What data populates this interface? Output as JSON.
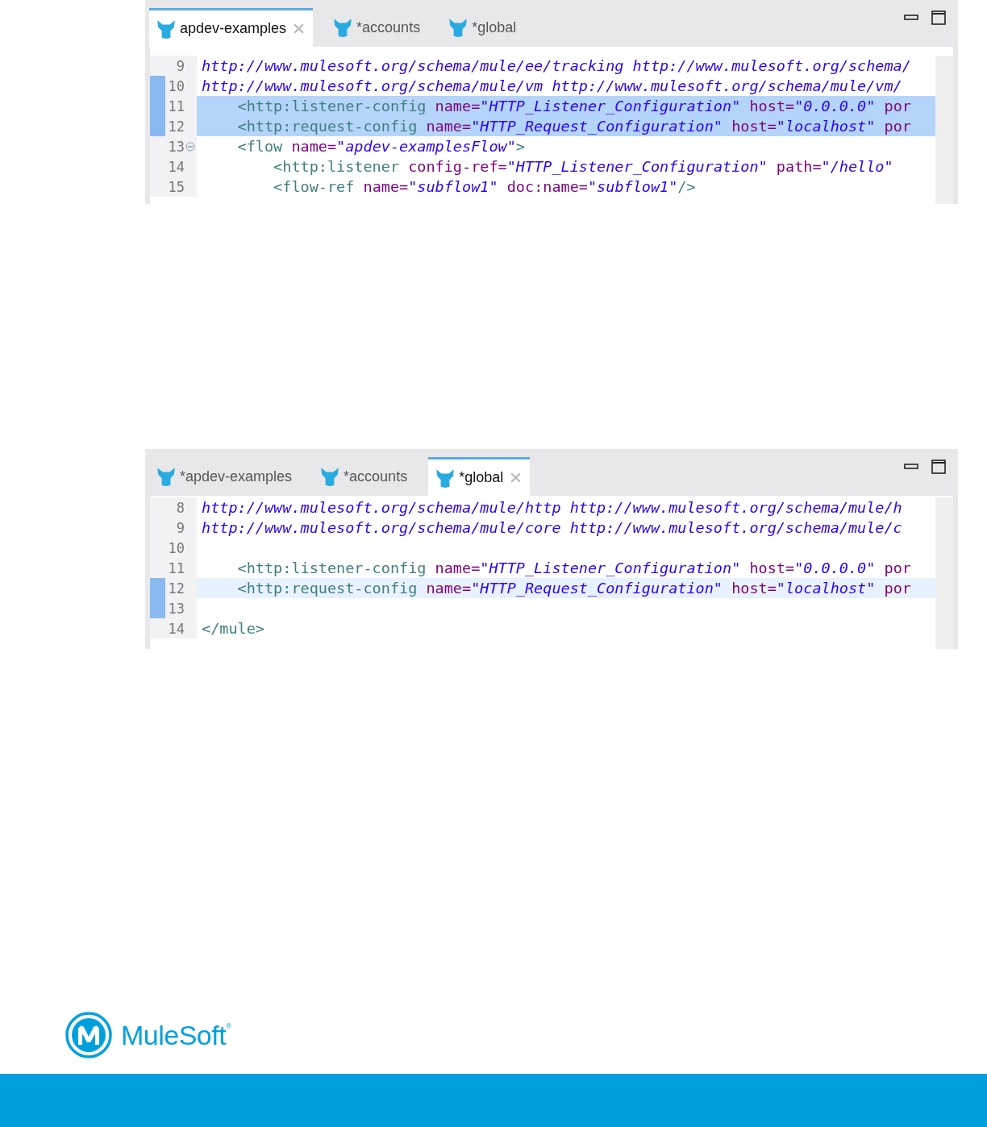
{
  "editors": [
    {
      "tabs": [
        {
          "label": "apdev-examples",
          "selected": true
        },
        {
          "label": "*accounts",
          "selected": false
        },
        {
          "label": "*global",
          "selected": false
        }
      ],
      "lines": [
        {
          "number": "9",
          "selected": false,
          "current": false,
          "changed": false,
          "fold": false,
          "tokens": [
            {
              "kind": "url",
              "text": "http://www.mulesoft.org/schema/mule/ee/tracking http://www.mulesoft.org/schema/"
            }
          ]
        },
        {
          "number": "10",
          "selected": false,
          "current": false,
          "changed": true,
          "fold": false,
          "tokens": [
            {
              "kind": "url",
              "text": "http://www.mulesoft.org/schema/mule/vm http://www.mulesoft.org/schema/mule/vm/"
            }
          ]
        },
        {
          "number": "11",
          "selected": true,
          "current": false,
          "changed": true,
          "fold": false,
          "tokens": [
            {
              "kind": "tag",
              "text": "    <http:listener-config"
            },
            {
              "kind": "attr",
              "text": " name="
            },
            {
              "kind": "value",
              "text": "\"HTTP_Listener_Configuration\""
            },
            {
              "kind": "attr",
              "text": " host="
            },
            {
              "kind": "value",
              "text": "\"0.0.0.0\""
            },
            {
              "kind": "attr",
              "text": " por"
            }
          ]
        },
        {
          "number": "12",
          "selected": true,
          "current": false,
          "changed": true,
          "fold": false,
          "tokens": [
            {
              "kind": "tag",
              "text": "    <http:request-config"
            },
            {
              "kind": "attr",
              "text": " name="
            },
            {
              "kind": "value",
              "text": "\"HTTP_Request_Configuration\""
            },
            {
              "kind": "attr",
              "text": " host="
            },
            {
              "kind": "value",
              "text": "\"localhost\""
            },
            {
              "kind": "attr",
              "text": " por"
            }
          ]
        },
        {
          "number": "13",
          "selected": false,
          "current": false,
          "changed": false,
          "fold": true,
          "tokens": [
            {
              "kind": "tag",
              "text": "    <flow"
            },
            {
              "kind": "attr",
              "text": " name="
            },
            {
              "kind": "value",
              "text": "\"apdev-examplesFlow\""
            },
            {
              "kind": "tag",
              "text": ">"
            }
          ]
        },
        {
          "number": "14",
          "selected": false,
          "current": false,
          "changed": false,
          "fold": false,
          "tokens": [
            {
              "kind": "tag",
              "text": "        <http:listener"
            },
            {
              "kind": "attr",
              "text": " config-ref="
            },
            {
              "kind": "value",
              "text": "\"HTTP_Listener_Configuration\""
            },
            {
              "kind": "attr",
              "text": " path="
            },
            {
              "kind": "value",
              "text": "\"/hello\""
            }
          ]
        },
        {
          "number": "15",
          "selected": false,
          "current": false,
          "changed": false,
          "fold": false,
          "tokens": [
            {
              "kind": "tag",
              "text": "        <flow-ref"
            },
            {
              "kind": "attr",
              "text": " name="
            },
            {
              "kind": "value",
              "text": "\"subflow1\""
            },
            {
              "kind": "attr",
              "text": " doc:name="
            },
            {
              "kind": "value",
              "text": "\"subflow1\""
            },
            {
              "kind": "tag",
              "text": "/>"
            }
          ]
        }
      ]
    },
    {
      "tabs": [
        {
          "label": "*apdev-examples",
          "selected": false
        },
        {
          "label": "*accounts",
          "selected": false
        },
        {
          "label": "*global",
          "selected": true
        }
      ],
      "lines": [
        {
          "number": "8",
          "selected": false,
          "current": false,
          "changed": false,
          "fold": false,
          "tokens": [
            {
              "kind": "url",
              "text": "http://www.mulesoft.org/schema/mule/http http://www.mulesoft.org/schema/mule/h"
            }
          ]
        },
        {
          "number": "9",
          "selected": false,
          "current": false,
          "changed": false,
          "fold": false,
          "tokens": [
            {
              "kind": "url",
              "text": "http://www.mulesoft.org/schema/mule/core http://www.mulesoft.org/schema/mule/c"
            }
          ]
        },
        {
          "number": "10",
          "selected": false,
          "current": false,
          "changed": false,
          "fold": false
        },
        {
          "number": "11",
          "selected": false,
          "current": false,
          "changed": false,
          "fold": false,
          "tokens": [
            {
              "kind": "tag",
              "text": "    <http:listener-config"
            },
            {
              "kind": "attr",
              "text": " name="
            },
            {
              "kind": "value",
              "text": "\"HTTP_Listener_Configuration\""
            },
            {
              "kind": "attr",
              "text": " host="
            },
            {
              "kind": "value",
              "text": "\"0.0.0.0\""
            },
            {
              "kind": "attr",
              "text": " por"
            }
          ]
        },
        {
          "number": "12",
          "selected": false,
          "current": true,
          "changed": true,
          "fold": false,
          "tokens": [
            {
              "kind": "tag",
              "text": "    <http:request-config"
            },
            {
              "kind": "attr",
              "text": " name="
            },
            {
              "kind": "value",
              "text": "\"HTTP_Request_Configuration\""
            },
            {
              "kind": "attr",
              "text": " host="
            },
            {
              "kind": "value",
              "text": "\"localhost\""
            },
            {
              "kind": "attr",
              "text": " por"
            }
          ]
        },
        {
          "number": "13",
          "selected": false,
          "current": false,
          "changed": true,
          "fold": false
        },
        {
          "number": "14",
          "selected": false,
          "current": false,
          "changed": false,
          "fold": false,
          "tokens": [
            {
              "kind": "tag",
              "text": "</mule>"
            }
          ]
        }
      ]
    }
  ],
  "logo": {
    "name": "MuleSoft",
    "mark": "®"
  }
}
